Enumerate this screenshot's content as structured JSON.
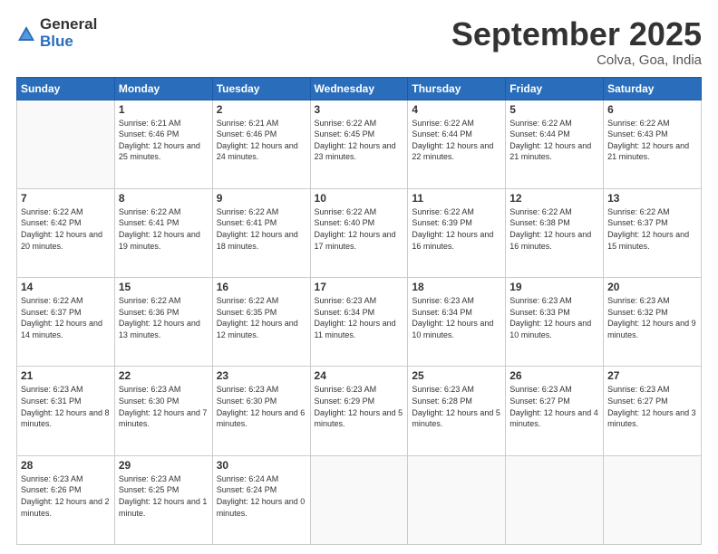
{
  "logo": {
    "general": "General",
    "blue": "Blue"
  },
  "title": "September 2025",
  "location": "Colva, Goa, India",
  "weekdays": [
    "Sunday",
    "Monday",
    "Tuesday",
    "Wednesday",
    "Thursday",
    "Friday",
    "Saturday"
  ],
  "weeks": [
    [
      {
        "day": "",
        "sunrise": "",
        "sunset": "",
        "daylight": ""
      },
      {
        "day": "1",
        "sunrise": "Sunrise: 6:21 AM",
        "sunset": "Sunset: 6:46 PM",
        "daylight": "Daylight: 12 hours and 25 minutes."
      },
      {
        "day": "2",
        "sunrise": "Sunrise: 6:21 AM",
        "sunset": "Sunset: 6:46 PM",
        "daylight": "Daylight: 12 hours and 24 minutes."
      },
      {
        "day": "3",
        "sunrise": "Sunrise: 6:22 AM",
        "sunset": "Sunset: 6:45 PM",
        "daylight": "Daylight: 12 hours and 23 minutes."
      },
      {
        "day": "4",
        "sunrise": "Sunrise: 6:22 AM",
        "sunset": "Sunset: 6:44 PM",
        "daylight": "Daylight: 12 hours and 22 minutes."
      },
      {
        "day": "5",
        "sunrise": "Sunrise: 6:22 AM",
        "sunset": "Sunset: 6:44 PM",
        "daylight": "Daylight: 12 hours and 21 minutes."
      },
      {
        "day": "6",
        "sunrise": "Sunrise: 6:22 AM",
        "sunset": "Sunset: 6:43 PM",
        "daylight": "Daylight: 12 hours and 21 minutes."
      }
    ],
    [
      {
        "day": "7",
        "sunrise": "Sunrise: 6:22 AM",
        "sunset": "Sunset: 6:42 PM",
        "daylight": "Daylight: 12 hours and 20 minutes."
      },
      {
        "day": "8",
        "sunrise": "Sunrise: 6:22 AM",
        "sunset": "Sunset: 6:41 PM",
        "daylight": "Daylight: 12 hours and 19 minutes."
      },
      {
        "day": "9",
        "sunrise": "Sunrise: 6:22 AM",
        "sunset": "Sunset: 6:41 PM",
        "daylight": "Daylight: 12 hours and 18 minutes."
      },
      {
        "day": "10",
        "sunrise": "Sunrise: 6:22 AM",
        "sunset": "Sunset: 6:40 PM",
        "daylight": "Daylight: 12 hours and 17 minutes."
      },
      {
        "day": "11",
        "sunrise": "Sunrise: 6:22 AM",
        "sunset": "Sunset: 6:39 PM",
        "daylight": "Daylight: 12 hours and 16 minutes."
      },
      {
        "day": "12",
        "sunrise": "Sunrise: 6:22 AM",
        "sunset": "Sunset: 6:38 PM",
        "daylight": "Daylight: 12 hours and 16 minutes."
      },
      {
        "day": "13",
        "sunrise": "Sunrise: 6:22 AM",
        "sunset": "Sunset: 6:37 PM",
        "daylight": "Daylight: 12 hours and 15 minutes."
      }
    ],
    [
      {
        "day": "14",
        "sunrise": "Sunrise: 6:22 AM",
        "sunset": "Sunset: 6:37 PM",
        "daylight": "Daylight: 12 hours and 14 minutes."
      },
      {
        "day": "15",
        "sunrise": "Sunrise: 6:22 AM",
        "sunset": "Sunset: 6:36 PM",
        "daylight": "Daylight: 12 hours and 13 minutes."
      },
      {
        "day": "16",
        "sunrise": "Sunrise: 6:22 AM",
        "sunset": "Sunset: 6:35 PM",
        "daylight": "Daylight: 12 hours and 12 minutes."
      },
      {
        "day": "17",
        "sunrise": "Sunrise: 6:23 AM",
        "sunset": "Sunset: 6:34 PM",
        "daylight": "Daylight: 12 hours and 11 minutes."
      },
      {
        "day": "18",
        "sunrise": "Sunrise: 6:23 AM",
        "sunset": "Sunset: 6:34 PM",
        "daylight": "Daylight: 12 hours and 10 minutes."
      },
      {
        "day": "19",
        "sunrise": "Sunrise: 6:23 AM",
        "sunset": "Sunset: 6:33 PM",
        "daylight": "Daylight: 12 hours and 10 minutes."
      },
      {
        "day": "20",
        "sunrise": "Sunrise: 6:23 AM",
        "sunset": "Sunset: 6:32 PM",
        "daylight": "Daylight: 12 hours and 9 minutes."
      }
    ],
    [
      {
        "day": "21",
        "sunrise": "Sunrise: 6:23 AM",
        "sunset": "Sunset: 6:31 PM",
        "daylight": "Daylight: 12 hours and 8 minutes."
      },
      {
        "day": "22",
        "sunrise": "Sunrise: 6:23 AM",
        "sunset": "Sunset: 6:30 PM",
        "daylight": "Daylight: 12 hours and 7 minutes."
      },
      {
        "day": "23",
        "sunrise": "Sunrise: 6:23 AM",
        "sunset": "Sunset: 6:30 PM",
        "daylight": "Daylight: 12 hours and 6 minutes."
      },
      {
        "day": "24",
        "sunrise": "Sunrise: 6:23 AM",
        "sunset": "Sunset: 6:29 PM",
        "daylight": "Daylight: 12 hours and 5 minutes."
      },
      {
        "day": "25",
        "sunrise": "Sunrise: 6:23 AM",
        "sunset": "Sunset: 6:28 PM",
        "daylight": "Daylight: 12 hours and 5 minutes."
      },
      {
        "day": "26",
        "sunrise": "Sunrise: 6:23 AM",
        "sunset": "Sunset: 6:27 PM",
        "daylight": "Daylight: 12 hours and 4 minutes."
      },
      {
        "day": "27",
        "sunrise": "Sunrise: 6:23 AM",
        "sunset": "Sunset: 6:27 PM",
        "daylight": "Daylight: 12 hours and 3 minutes."
      }
    ],
    [
      {
        "day": "28",
        "sunrise": "Sunrise: 6:23 AM",
        "sunset": "Sunset: 6:26 PM",
        "daylight": "Daylight: 12 hours and 2 minutes."
      },
      {
        "day": "29",
        "sunrise": "Sunrise: 6:23 AM",
        "sunset": "Sunset: 6:25 PM",
        "daylight": "Daylight: 12 hours and 1 minute."
      },
      {
        "day": "30",
        "sunrise": "Sunrise: 6:24 AM",
        "sunset": "Sunset: 6:24 PM",
        "daylight": "Daylight: 12 hours and 0 minutes."
      },
      {
        "day": "",
        "sunrise": "",
        "sunset": "",
        "daylight": ""
      },
      {
        "day": "",
        "sunrise": "",
        "sunset": "",
        "daylight": ""
      },
      {
        "day": "",
        "sunrise": "",
        "sunset": "",
        "daylight": ""
      },
      {
        "day": "",
        "sunrise": "",
        "sunset": "",
        "daylight": ""
      }
    ]
  ]
}
